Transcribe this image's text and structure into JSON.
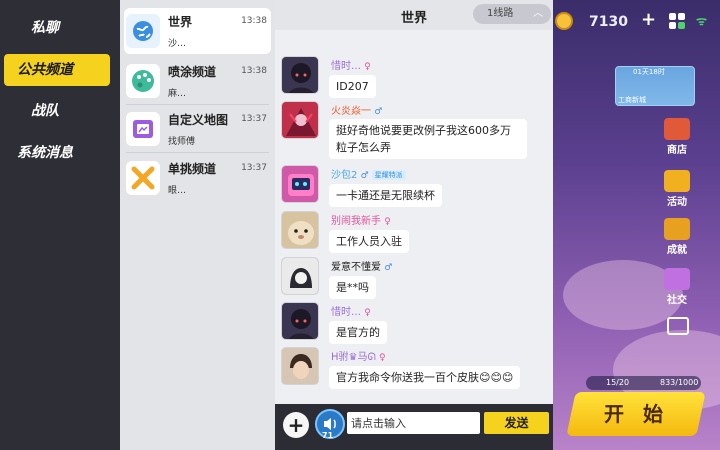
{
  "categories": [
    {
      "label": "私聊",
      "active": false
    },
    {
      "label": "公共频道",
      "active": true
    },
    {
      "label": "战队",
      "active": false
    },
    {
      "label": "系统消息",
      "active": false
    }
  ],
  "channels": [
    {
      "name": "世界",
      "time": "13:38",
      "preview": "沙…",
      "icon": "globe-icon",
      "color": "#3b8fe0"
    },
    {
      "name": "喷涂频道",
      "time": "13:38",
      "preview": "麻…",
      "icon": "palette-icon",
      "color": "#3dbb9a"
    },
    {
      "name": "自定义地图",
      "time": "13:37",
      "preview": "找师傅",
      "icon": "map-editor-icon",
      "color": "#9b5ce0"
    },
    {
      "name": "单挑频道",
      "time": "13:37",
      "preview": "眼…",
      "icon": "crossed-swords-icon",
      "color": "#f5a623"
    }
  ],
  "chat": {
    "title": "世界",
    "line_selector": "1线路",
    "input_placeholder": "请点击输入",
    "send_label": "发送",
    "voice_count": "71",
    "messages": [
      {
        "sender": "惜时…",
        "gender": "♀",
        "text": "ID207",
        "avatar_color": "#3a3550"
      },
      {
        "sender": "火炎焱一",
        "gender": "♂",
        "text": "挺好奇他说要更改例子我这600多万粒子怎么弄",
        "avatar_color": "#c0304a"
      },
      {
        "sender": "沙包2",
        "gender": "♂",
        "badge": "星耀特派",
        "text": "一卡通还是无限续杯",
        "avatar_color": "#d05aa8"
      },
      {
        "sender": "别闹我新手",
        "gender": "♀",
        "text": "工作人员入驻",
        "avatar_color": "#d8c3a0"
      },
      {
        "sender": "爱意不懂爱",
        "gender": "♂",
        "text": "是**吗",
        "avatar_color": "#7a7a84"
      },
      {
        "sender": "惜时…",
        "gender": "♀",
        "text": "是官方的",
        "avatar_color": "#3a3550"
      },
      {
        "sender": "ᕼ驸♛马ᘏ",
        "gender": "♀",
        "text": "官方我命令你送我一百个皮肤😊😊😊",
        "avatar_color": "#b89a80"
      }
    ]
  },
  "game": {
    "coins": "7130",
    "map_time": "01天18时",
    "map_label": "工商新城",
    "side_buttons": [
      {
        "label": "商店",
        "icon": "shop-icon",
        "color": "#e05a3a"
      },
      {
        "label": "活动",
        "icon": "gift-icon",
        "color": "#f0b020"
      },
      {
        "label": "成就",
        "icon": "trophy-icon",
        "color": "#e8a020"
      },
      {
        "label": "社交",
        "icon": "social-icon",
        "color": "#c070e0"
      }
    ],
    "stat_a": "15/20",
    "stat_b": "833/1000",
    "start_label": "开 始"
  }
}
